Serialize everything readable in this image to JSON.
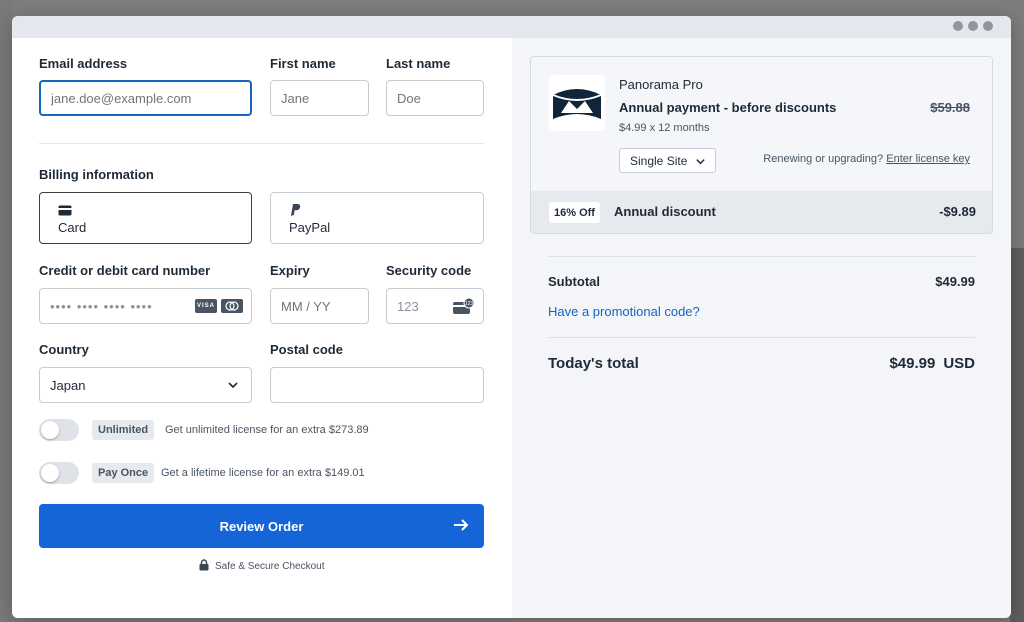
{
  "colors": {
    "accent": "#1565d8",
    "link": "#1565c0",
    "logo": "#10243a"
  },
  "form": {
    "email_label": "Email address",
    "email_placeholder": "jane.doe@example.com",
    "first_name_label": "First name",
    "first_name_placeholder": "Jane",
    "last_name_label": "Last name",
    "last_name_placeholder": "Doe",
    "billing_label": "Billing information",
    "payment_methods": [
      {
        "label": "Card",
        "icon": "credit-card-icon",
        "selected": true
      },
      {
        "label": "PayPal",
        "icon": "paypal-icon",
        "selected": false
      }
    ],
    "card_number_label": "Credit or debit card number",
    "card_number_placeholder": "•••• •••• •••• ••••",
    "card_brands": [
      "VISA",
      "mastercard"
    ],
    "expiry_label": "Expiry",
    "expiry_placeholder": "MM / YY",
    "security_label": "Security code",
    "security_placeholder": "123",
    "country_label": "Country",
    "country_value": "Japan",
    "postal_label": "Postal code",
    "postal_value": "",
    "options": [
      {
        "badge": "Unlimited",
        "description": "Get unlimited license for an extra $273.89",
        "enabled": false
      },
      {
        "badge": "Pay Once",
        "description": "Get a lifetime license for an extra $149.01",
        "enabled": false
      }
    ],
    "review_button": "Review Order",
    "secure_text": "Safe & Secure Checkout"
  },
  "summary": {
    "product_name": "Panorama Pro",
    "product_desc": "Annual payment - before discounts",
    "product_price_detail": "$4.99 x 12 months",
    "original_price": "$59.88",
    "site_option": "Single Site",
    "renew_text": "Renewing or upgrading?",
    "renew_link": "Enter license key",
    "discount_badge": "16% Off",
    "discount_label": "Annual discount",
    "discount_amount": "-$9.89",
    "subtotal_label": "Subtotal",
    "subtotal_value": "$49.99",
    "promo_link": "Have a promotional code?",
    "total_label": "Today's total",
    "total_value": "$49.99",
    "total_currency": "USD"
  }
}
